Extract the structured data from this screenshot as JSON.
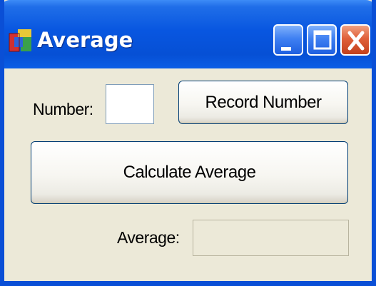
{
  "window": {
    "title": "Average",
    "icons": {
      "app": "application-icon",
      "minimize": "minimize-icon",
      "maximize": "maximize-icon",
      "close": "close-icon"
    }
  },
  "form": {
    "number_label": "Number:",
    "number_value": "",
    "record_button": "Record Number",
    "calculate_button": "Calculate Average",
    "average_label": "Average:",
    "average_value": ""
  },
  "colors": {
    "titlebar": "#0856e0",
    "window_frame": "#0a4fd6",
    "client_background": "#ece9d8",
    "close_button": "#e0603a",
    "button_border": "#003c74"
  }
}
